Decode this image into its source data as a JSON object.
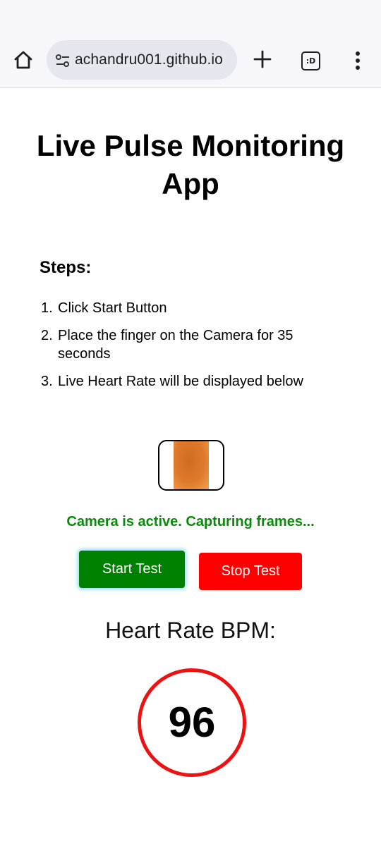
{
  "browser": {
    "url": "achandru001.github.io",
    "tabs_badge": ":D",
    "icons": {
      "home": "home-icon",
      "site_settings": "tune-icon",
      "new_tab": "plus-icon",
      "tabs": "tab-switcher-icon",
      "menu": "more-vert-icon"
    }
  },
  "page": {
    "title": "Live Pulse Monitoring App",
    "steps_title": "Steps:",
    "steps": [
      {
        "num": "1.",
        "text": "Click Start Button"
      },
      {
        "num": "2.",
        "text": "Place the finger on the Camera for 35 seconds"
      },
      {
        "num": "3.",
        "text": "Live Heart Rate will be displayed below"
      }
    ],
    "status": "Camera is active. Capturing frames...",
    "start_button": "Start Test",
    "stop_button": "Stop Test",
    "heart_rate_label": "Heart Rate BPM:",
    "heart_rate_value": "96"
  },
  "colors": {
    "status_text": "#0a8a0a",
    "start_button": "#008000",
    "stop_button": "#ff0000",
    "bpm_ring": "#ee1111"
  }
}
